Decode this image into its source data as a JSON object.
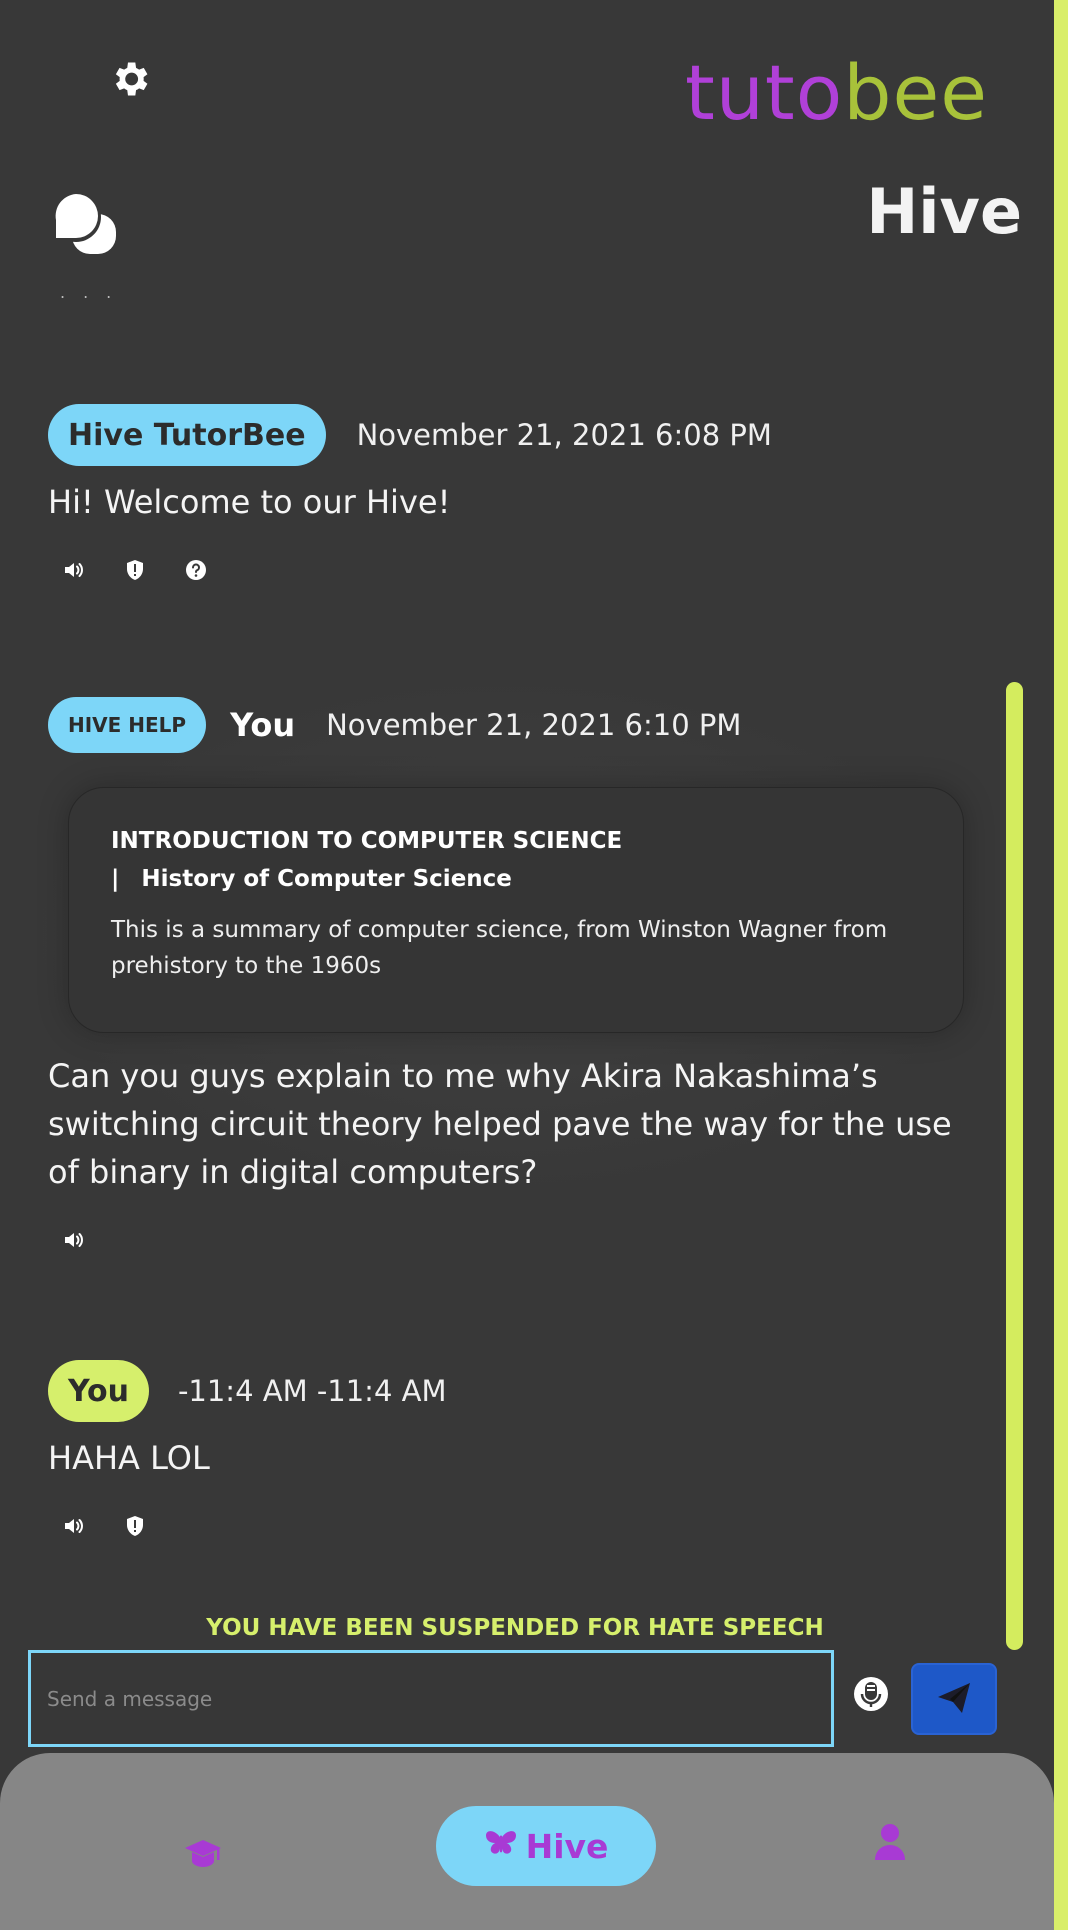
{
  "app": {
    "logo_part1": "tuto",
    "logo_part2": "bee",
    "page_title": "Hive"
  },
  "clipped_previous_text": "...",
  "messages": [
    {
      "sender": "Hive TutorBee",
      "timestamp": "November 21, 2021 6:08 PM",
      "text": "Hi! Welcome to our Hive!",
      "icons": [
        "speaker-icon",
        "report-icon",
        "help-icon"
      ]
    },
    {
      "tag": "HIVE HELP",
      "sender": "You",
      "timestamp": "November 21, 2021 6:10 PM",
      "card": {
        "course": "INTRODUCTION TO COMPUTER SCIENCE",
        "bar": "|",
        "topic": "History of Computer Science",
        "summary": "This is a summary of computer science, from Winston Wagner from prehistory to the 1960s"
      },
      "text": "Can you guys explain to me why Akira Nakashima’s switching circuit theory helped pave the way for the use of binary in digital computers?",
      "icons": [
        "speaker-icon"
      ]
    },
    {
      "sender": "You",
      "timestamp": "-11:4 AM -11:4 AM",
      "text": "HAHA LOL",
      "icons": [
        "speaker-icon",
        "report-icon"
      ]
    }
  ],
  "composer": {
    "status": "YOU HAVE BEEN SUSPENDED FOR HATE SPEECH",
    "placeholder": "Send a message",
    "value": ""
  },
  "nav": {
    "hive_label": "Hive",
    "active": "hive"
  },
  "colors": {
    "accent_blue": "#7dd6f8",
    "accent_lime": "#d6ef6c",
    "logo_purple": "#b040d8",
    "logo_green": "#a8c23a",
    "send_blue": "#1e58c8"
  }
}
